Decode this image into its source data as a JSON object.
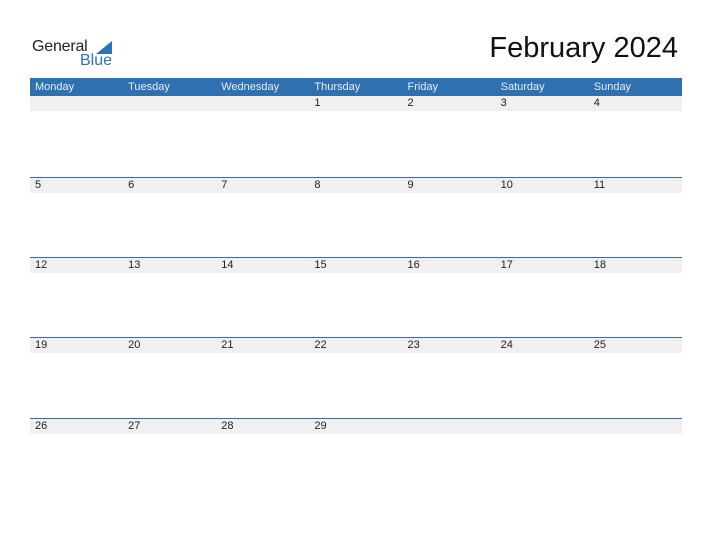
{
  "logo": {
    "general": "General",
    "blue": "Blue"
  },
  "title": "February 2024",
  "days": [
    "Monday",
    "Tuesday",
    "Wednesday",
    "Thursday",
    "Friday",
    "Saturday",
    "Sunday"
  ],
  "weeks": [
    [
      "",
      "",
      "",
      "1",
      "2",
      "3",
      "4"
    ],
    [
      "5",
      "6",
      "7",
      "8",
      "9",
      "10",
      "11"
    ],
    [
      "12",
      "13",
      "14",
      "15",
      "16",
      "17",
      "18"
    ],
    [
      "19",
      "20",
      "21",
      "22",
      "23",
      "24",
      "25"
    ],
    [
      "26",
      "27",
      "28",
      "29",
      "",
      "",
      ""
    ]
  ]
}
